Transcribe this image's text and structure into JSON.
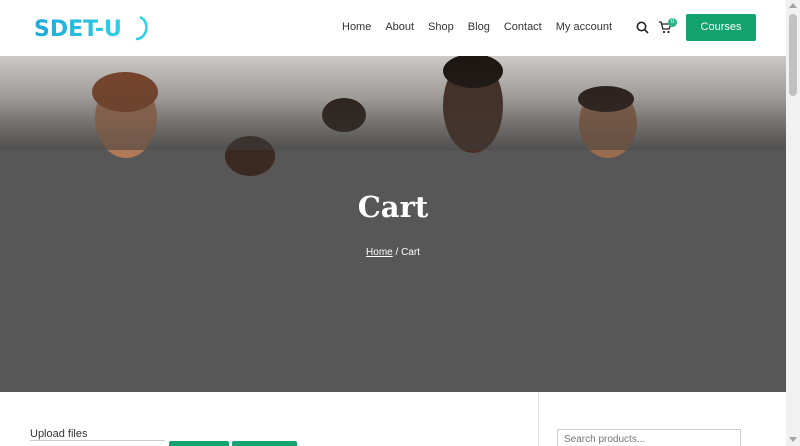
{
  "header": {
    "logo_text": "SDET-U",
    "nav": [
      "Home",
      "About",
      "Shop",
      "Blog",
      "Contact",
      "My account"
    ],
    "cart_count": "0",
    "courses_label": "Courses",
    "icons": {
      "search": "search-icon",
      "cart": "cart-icon"
    }
  },
  "hero": {
    "title": "Cart",
    "breadcrumb_home": "Home",
    "breadcrumb_sep": " / ",
    "breadcrumb_current": "Cart"
  },
  "content": {
    "upload_label": "Upload files",
    "search_placeholder": "Search products..."
  },
  "colors": {
    "accent": "#12a36e",
    "hero_bg": "#575757"
  }
}
